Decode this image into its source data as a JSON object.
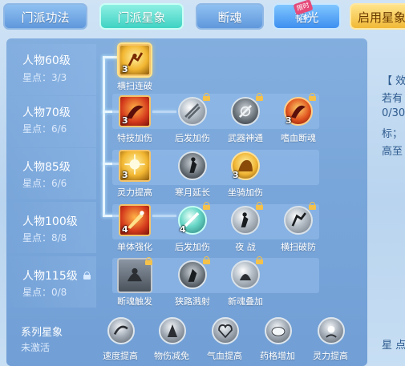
{
  "tabs": [
    {
      "label": "门派功法",
      "state": "default"
    },
    {
      "label": "门派星象",
      "state": "active"
    },
    {
      "label": "断魂",
      "state": "default"
    },
    {
      "label": "韬光",
      "state": "default",
      "badge": "限时中"
    },
    {
      "label": "启用星象",
      "state": "accent"
    }
  ],
  "rows": [
    {
      "name": "人物60级",
      "points": "星点：3/3",
      "locked": false
    },
    {
      "name": "人物70级",
      "points": "星点：6/6",
      "locked": false
    },
    {
      "name": "人物85级",
      "points": "星点：6/6",
      "locked": false
    },
    {
      "name": "人物100级",
      "points": "星点：8/8",
      "locked": false
    },
    {
      "name": "人物115级",
      "points": "星点：0/8",
      "locked": true
    }
  ],
  "nodes": {
    "r1": [
      {
        "label": "横扫连破",
        "level": "3",
        "icon": "sweep-break-icon",
        "locked": false
      }
    ],
    "r2": [
      {
        "label": "特技加伤",
        "level": "3",
        "icon": "skill-damage-icon",
        "locked": false
      },
      {
        "label": "后发加伤",
        "level": "",
        "icon": "counter-damage-icon",
        "locked": true
      },
      {
        "label": "武器神通",
        "level": "",
        "icon": "weapon-power-icon",
        "locked": true
      },
      {
        "label": "嗜血断魂",
        "level": "3",
        "icon": "bloodthirst-icon",
        "locked": true
      }
    ],
    "r3": [
      {
        "label": "灵力提高",
        "level": "3",
        "icon": "spirit-boost-icon",
        "locked": false
      },
      {
        "label": "寒月延长",
        "level": "",
        "icon": "cold-moon-icon",
        "locked": false
      },
      {
        "label": "坐骑加伤",
        "level": "3",
        "icon": "mount-damage-icon",
        "locked": false
      }
    ],
    "r4": [
      {
        "label": "单体强化",
        "level": "4",
        "icon": "single-target-icon",
        "locked": false
      },
      {
        "label": "后发加伤",
        "level": "4",
        "icon": "counter-damage-icon",
        "locked": true
      },
      {
        "label": "夜 战",
        "level": "",
        "icon": "night-fight-icon",
        "locked": true
      },
      {
        "label": "横扫破防",
        "level": "",
        "icon": "sweep-armor-icon",
        "locked": true
      }
    ],
    "r5": [
      {
        "label": "断魂触发",
        "level": "",
        "icon": "soul-trigger-icon",
        "locked": true
      },
      {
        "label": "狭路溅射",
        "level": "",
        "icon": "splash-icon",
        "locked": true
      },
      {
        "label": "新魂叠加",
        "level": "",
        "icon": "soul-stack-icon",
        "locked": true
      }
    ]
  },
  "series": {
    "title": "系列星象",
    "status": "未激活",
    "items": [
      {
        "label": "速度提高",
        "icon": "speed-icon"
      },
      {
        "label": "物伤减免",
        "icon": "phys-reduce-icon"
      },
      {
        "label": "气血提高",
        "icon": "hp-icon"
      },
      {
        "label": "药格增加",
        "icon": "potion-icon"
      },
      {
        "label": "灵力提高",
        "icon": "spirit-icon"
      }
    ]
  },
  "right_panel": {
    "lines": [
      "【 效",
      "若有",
      "0/30",
      "标；",
      "高至"
    ],
    "bottom": "星 点"
  },
  "colors": {
    "accent": "#3fd3c3",
    "gold": "#f5c46a",
    "panel": "#6a9ad2"
  }
}
